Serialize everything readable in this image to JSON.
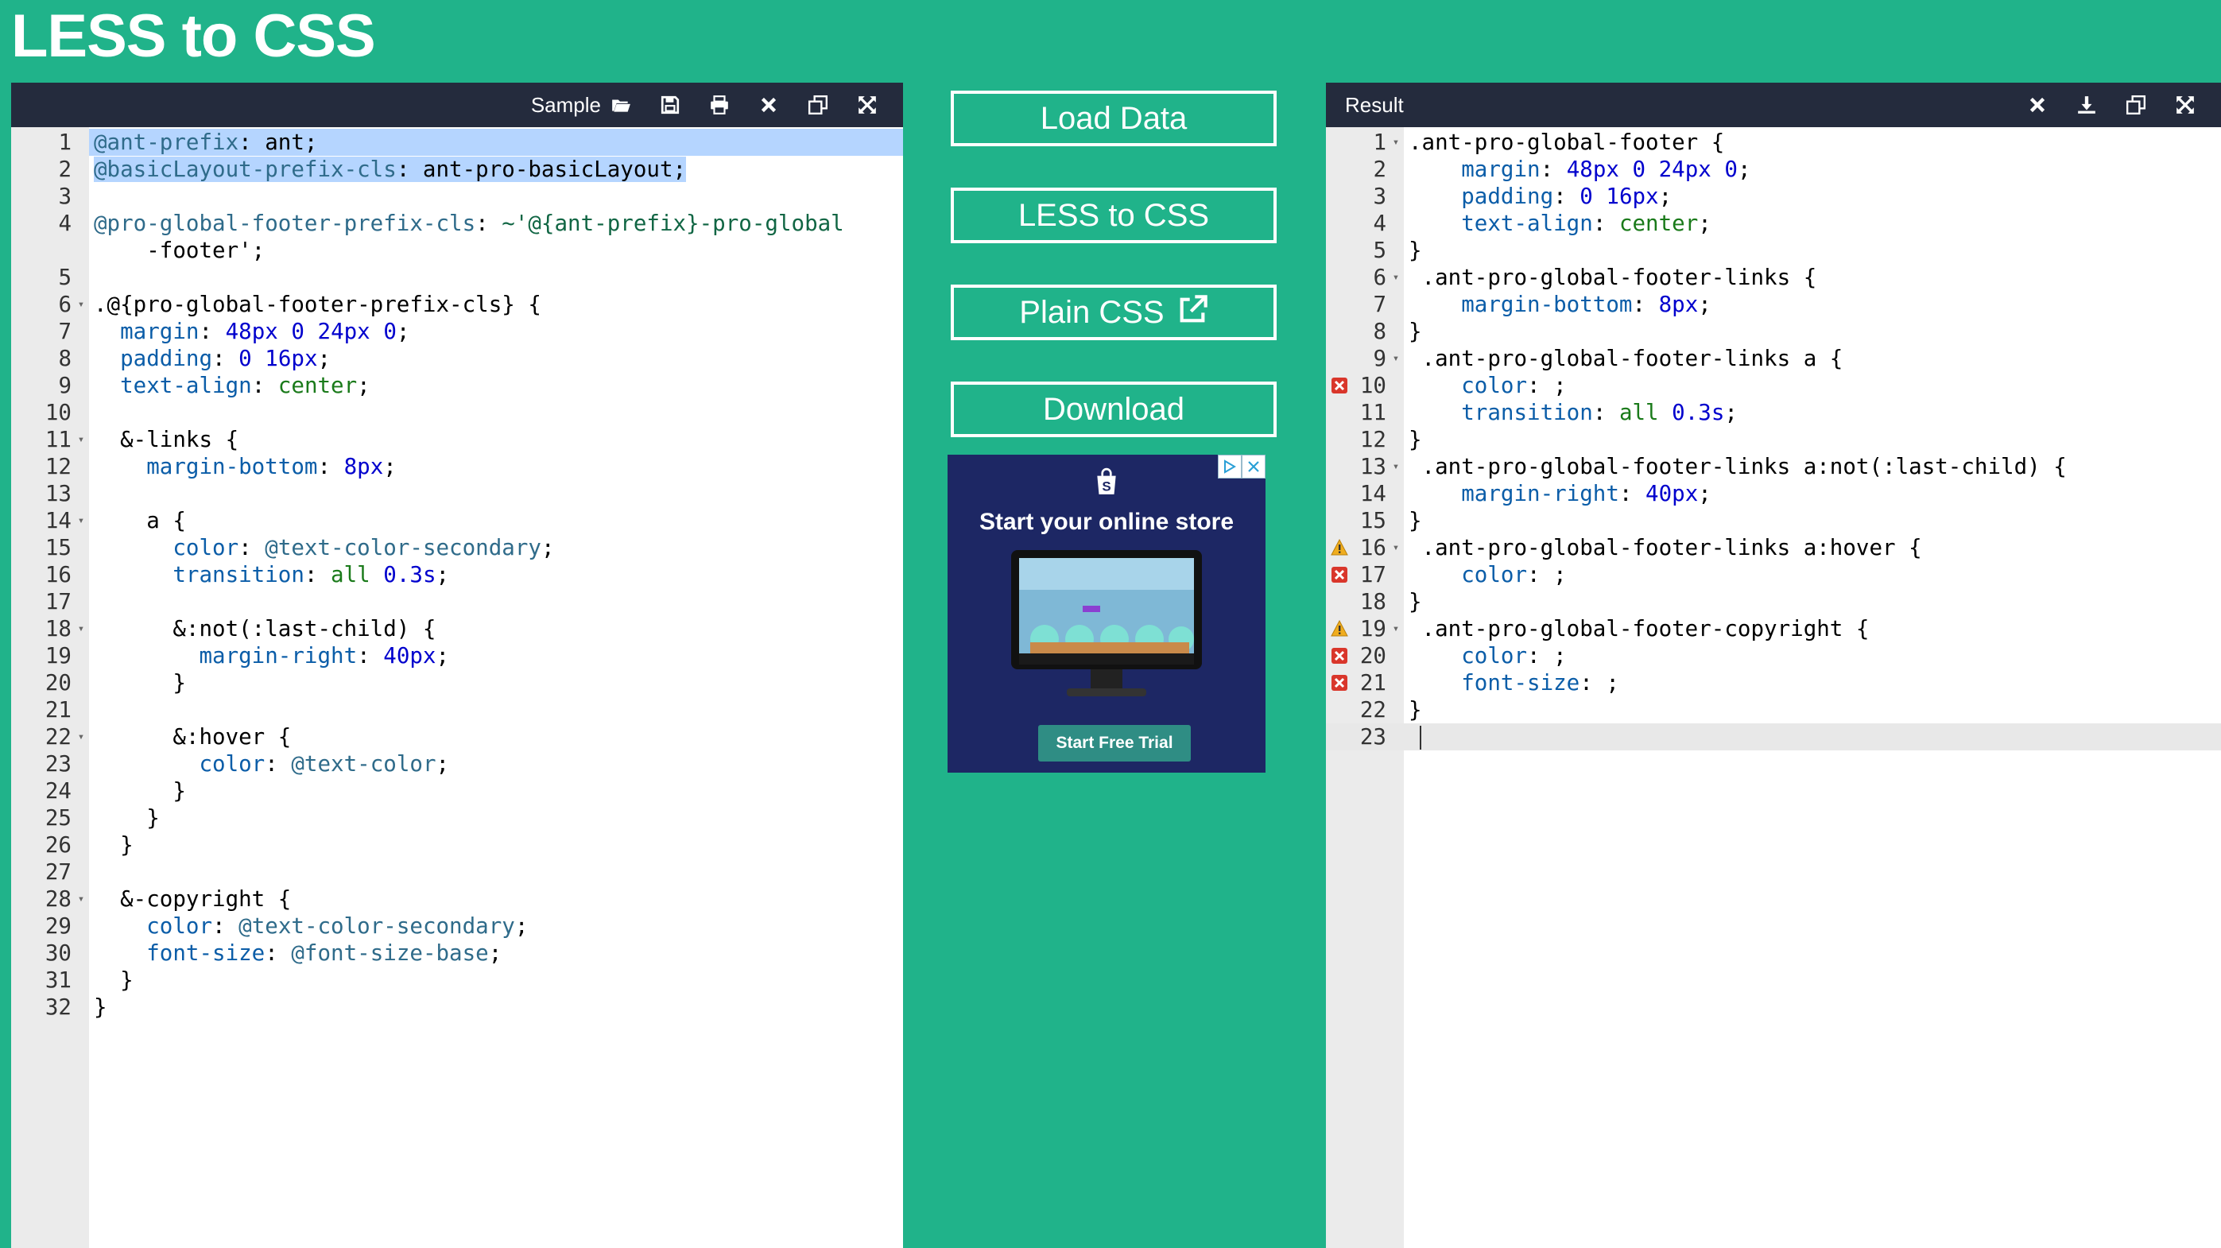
{
  "page": {
    "title": "LESS to CSS"
  },
  "left_panel": {
    "title": "Sample",
    "tools": [
      "folder-open-icon",
      "save-icon",
      "print-icon",
      "close-icon",
      "copy-icon",
      "expand-icon"
    ]
  },
  "right_panel": {
    "title": "Result",
    "tools": [
      "close-icon",
      "download-icon",
      "copy-icon",
      "expand-icon"
    ]
  },
  "actions": {
    "load": "Load Data",
    "convert": "LESS to CSS",
    "plain": "Plain CSS",
    "download": "Download"
  },
  "ad": {
    "heading": "Start your online store",
    "cta": "Start Free Trial"
  },
  "colors": {
    "background": "#20b38a",
    "header": "#242b3d",
    "selection": "#b5d5ff",
    "gutter": "#ebebeb"
  },
  "left_lines": [
    {
      "n": "1",
      "t": "@ant-prefix: ant;",
      "sel": true
    },
    {
      "n": "2",
      "t": "@basicLayout-prefix-cls: ant-pro-basicLayout;",
      "sel": true
    },
    {
      "n": "3",
      "t": ""
    },
    {
      "n": "4",
      "t": "@pro-global-footer-prefix-cls: ~'@{ant-prefix}-pro-global",
      "t2": "    -footer';"
    },
    {
      "n": "5",
      "t": ""
    },
    {
      "n": "6",
      "t": ".@{pro-global-footer-prefix-cls} {",
      "fold": true
    },
    {
      "n": "7",
      "t": "  margin: 48px 0 24px 0;"
    },
    {
      "n": "8",
      "t": "  padding: 0 16px;"
    },
    {
      "n": "9",
      "t": "  text-align: center;"
    },
    {
      "n": "10",
      "t": ""
    },
    {
      "n": "11",
      "t": "  &-links {",
      "fold": true
    },
    {
      "n": "12",
      "t": "    margin-bottom: 8px;"
    },
    {
      "n": "13",
      "t": ""
    },
    {
      "n": "14",
      "t": "    a {",
      "fold": true
    },
    {
      "n": "15",
      "t": "      color: @text-color-secondary;"
    },
    {
      "n": "16",
      "t": "      transition: all 0.3s;"
    },
    {
      "n": "17",
      "t": ""
    },
    {
      "n": "18",
      "t": "      &:not(:last-child) {",
      "fold": true
    },
    {
      "n": "19",
      "t": "        margin-right: 40px;"
    },
    {
      "n": "20",
      "t": "      }"
    },
    {
      "n": "21",
      "t": ""
    },
    {
      "n": "22",
      "t": "      &:hover {",
      "fold": true
    },
    {
      "n": "23",
      "t": "        color: @text-color;"
    },
    {
      "n": "24",
      "t": "      }"
    },
    {
      "n": "25",
      "t": "    }"
    },
    {
      "n": "26",
      "t": "  }"
    },
    {
      "n": "27",
      "t": ""
    },
    {
      "n": "28",
      "t": "  &-copyright {",
      "fold": true
    },
    {
      "n": "29",
      "t": "    color: @text-color-secondary;"
    },
    {
      "n": "30",
      "t": "    font-size: @font-size-base;"
    },
    {
      "n": "31",
      "t": "  }"
    },
    {
      "n": "32",
      "t": "}"
    }
  ],
  "right_lines": [
    {
      "n": "1",
      "t": ".ant-pro-global-footer {",
      "fold": true
    },
    {
      "n": "2",
      "t": "    margin: 48px 0 24px 0;"
    },
    {
      "n": "3",
      "t": "    padding: 0 16px;"
    },
    {
      "n": "4",
      "t": "    text-align: center;"
    },
    {
      "n": "5",
      "t": "}"
    },
    {
      "n": "6",
      "t": " .ant-pro-global-footer-links {",
      "fold": true
    },
    {
      "n": "7",
      "t": "    margin-bottom: 8px;"
    },
    {
      "n": "8",
      "t": "}"
    },
    {
      "n": "9",
      "t": " .ant-pro-global-footer-links a {",
      "fold": true
    },
    {
      "n": "10",
      "t": "    color: ;",
      "mark": "error"
    },
    {
      "n": "11",
      "t": "    transition: all 0.3s;"
    },
    {
      "n": "12",
      "t": "}"
    },
    {
      "n": "13",
      "t": " .ant-pro-global-footer-links a:not(:last-child) {",
      "fold": true
    },
    {
      "n": "14",
      "t": "    margin-right: 40px;"
    },
    {
      "n": "15",
      "t": "}"
    },
    {
      "n": "16",
      "t": " .ant-pro-global-footer-links a:hover {",
      "fold": true,
      "mark": "warning"
    },
    {
      "n": "17",
      "t": "    color: ;",
      "mark": "error"
    },
    {
      "n": "18",
      "t": "}"
    },
    {
      "n": "19",
      "t": " .ant-pro-global-footer-copyright {",
      "fold": true,
      "mark": "warning"
    },
    {
      "n": "20",
      "t": "    color: ;",
      "mark": "error"
    },
    {
      "n": "21",
      "t": "    font-size: ;",
      "mark": "error"
    },
    {
      "n": "22",
      "t": "}"
    },
    {
      "n": "23",
      "t": "",
      "active": true
    }
  ]
}
